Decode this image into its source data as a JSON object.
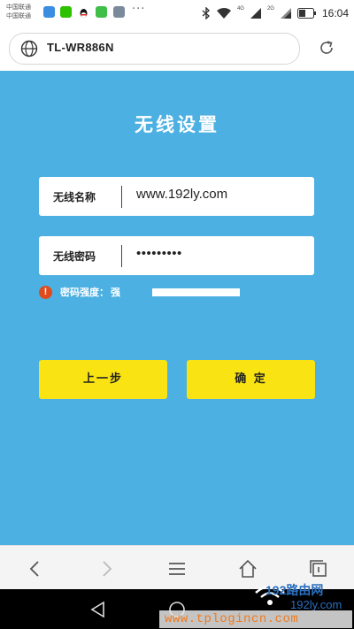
{
  "status_bar": {
    "carrier_line1": "中国联通",
    "carrier_line2": "中国联通",
    "overflow": "···",
    "network1": "4G",
    "network2": "2G",
    "time": "16:04"
  },
  "browser": {
    "url": "TL-WR886N"
  },
  "page": {
    "title": "无线设置",
    "ssid_label": "无线名称",
    "ssid_value": "www.192ly.com",
    "password_label": "无线密码",
    "password_value": "•••••••••",
    "strength_warning": "!",
    "strength_label": "密码强度：",
    "strength_value": "强",
    "strength_level": 1.0,
    "prev_button": "上一步",
    "confirm_button": "确 定"
  },
  "watermark": {
    "brand": "192路由网",
    "brand_small": "192ly.com",
    "url": "www.tplogincn.com"
  },
  "colors": {
    "panel": "#4cb0e2",
    "button": "#f9e312",
    "warning": "#e04a1c"
  }
}
